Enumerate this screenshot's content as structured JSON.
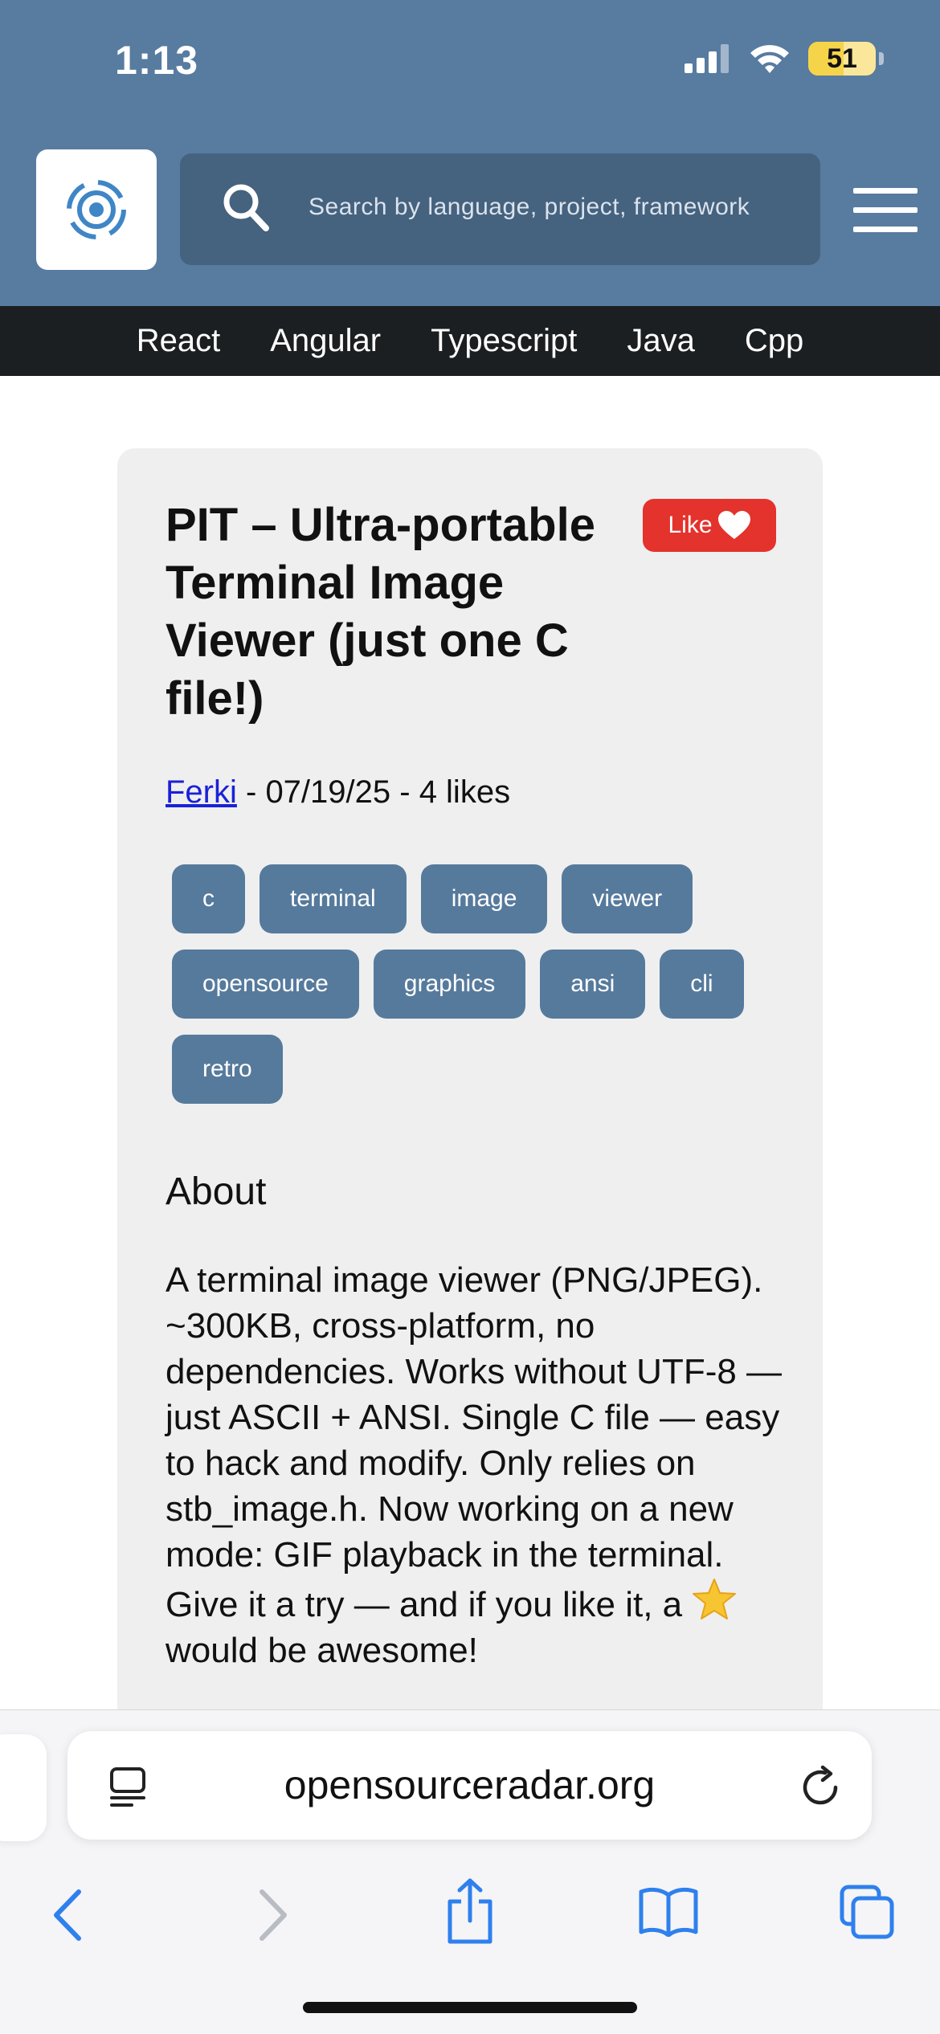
{
  "status": {
    "time": "1:13",
    "battery": "51",
    "icons": [
      "cellular-signal-icon",
      "wifi-icon",
      "battery-icon"
    ]
  },
  "header": {
    "logo_icon": "radar-logo-icon",
    "search_placeholder": "Search by language, project, framework",
    "menu_icon": "hamburger-menu-icon"
  },
  "categories": [
    "React",
    "Angular",
    "Typescript",
    "Java",
    "Cpp"
  ],
  "post": {
    "title": "PIT – Ultra-portable Terminal Image Viewer (just one C file!)",
    "like_label": "Like",
    "author": "Ferki",
    "meta_rest": " - 07/19/25 - 4 likes",
    "tags": [
      "c",
      "terminal",
      "image",
      "viewer",
      "opensource",
      "graphics",
      "ansi",
      "cli",
      "retro"
    ],
    "about_heading": "About",
    "about_text_1": "A terminal image viewer (PNG/JPEG). ~300KB, cross-platform, no dependencies. Works without UTF-8 — just ASCII + ANSI. Single C file — easy to hack and modify. Only relies on stb_image.h. Now working on a new mode: GIF playback in the terminal. Give it a try — and if you like it, a ",
    "about_text_2": " would be awesome!"
  },
  "browser": {
    "url": "opensourceradar.org",
    "toolbar": [
      "back-icon",
      "forward-icon",
      "share-icon",
      "bookmarks-icon",
      "tabs-icon"
    ]
  },
  "colors": {
    "header_blue": "#587ba0",
    "search_bg": "#45627f",
    "nav_dark": "#1c1f21",
    "tag_blue": "#567a9c",
    "like_red": "#e4322c",
    "link_blue": "#1a22d6"
  }
}
